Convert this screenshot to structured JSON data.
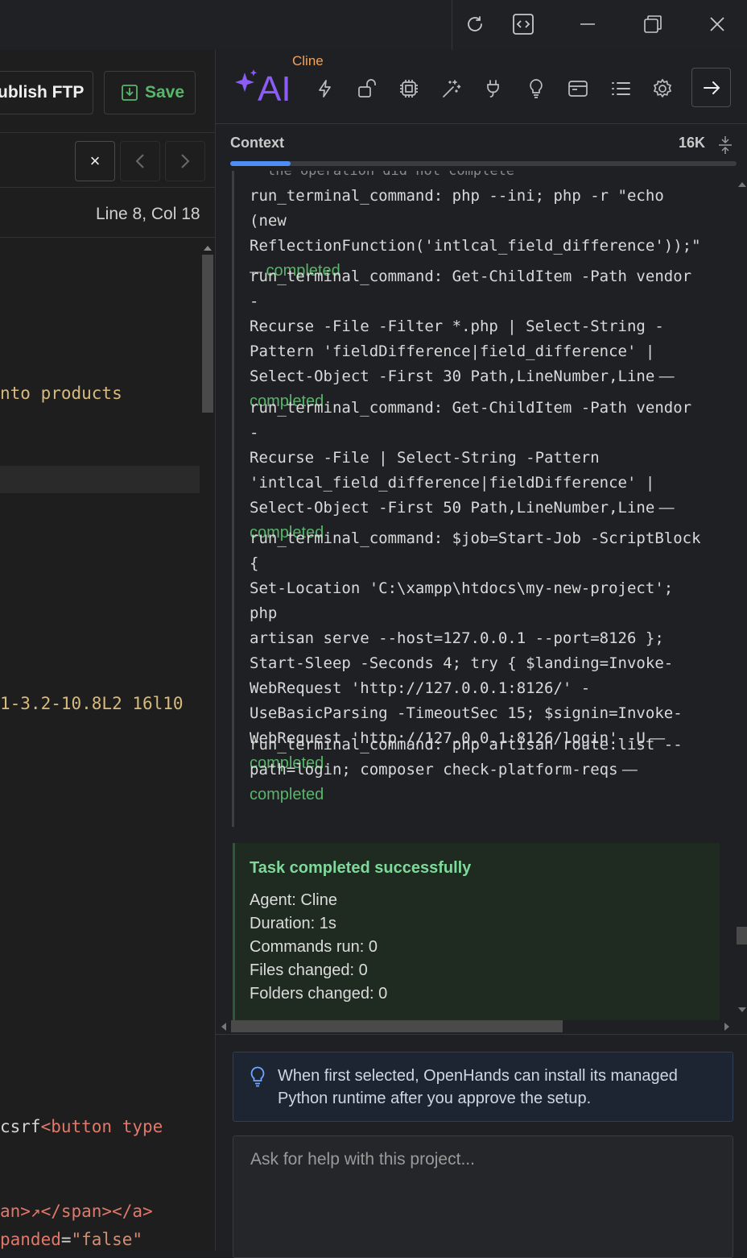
{
  "toolbar": {
    "publish_label": "ublish FTP",
    "save_label": "Save"
  },
  "editor": {
    "close_glyph": "×",
    "cursor_position": "Line 8, Col 18",
    "code_lines": {
      "l1": "nto products",
      "l2": "1-3.2-10.8L2 16l10",
      "l3_a": "csrf",
      "l3_b": "<button type",
      "l4_a": "an>↗</span></a>",
      "l5_a": "panded",
      "l5_b": "=",
      "l5_c": "\"false\""
    }
  },
  "ai_panel": {
    "agent_name": "Cline",
    "logo_text": "AI",
    "context_label": "Context",
    "context_tokens": "16K",
    "context_fill": 0.12,
    "clipped_line": "the operation did not complete",
    "entries": [
      {
        "lines": [
          "run_terminal_command: php --ini; php -r \"echo (new",
          "ReflectionFunction('intlcal_field_difference'));\""
        ],
        "suffix": "— ",
        "status": "completed",
        "status_inline": true
      },
      {
        "lines": [
          "run_terminal_command: Get-ChildItem -Path vendor -",
          "Recurse -File -Filter *.php | Select-String -",
          "Pattern 'fieldDifference|field_difference' |",
          "Select-Object -First 30 Path,LineNumber,Line"
        ],
        "suffix": " —",
        "status": "completed"
      },
      {
        "lines": [
          "run_terminal_command: Get-ChildItem -Path vendor -",
          "Recurse -File | Select-String -Pattern",
          "'intlcal_field_difference|fieldDifference' |",
          "Select-Object -First 50 Path,LineNumber,Line"
        ],
        "suffix": " —",
        "status": "completed"
      },
      {
        "lines": [
          "run_terminal_command: $job=Start-Job -ScriptBlock {",
          "Set-Location 'C:\\xampp\\htdocs\\my-new-project'; php",
          "artisan serve --host=127.0.0.1 --port=8126 };",
          "Start-Sleep -Seconds 4; try { $landing=Invoke-",
          "WebRequest 'http://127.0.0.1:8126/' -",
          "UseBasicParsing -TimeoutSec 15; $signin=Invoke-",
          "WebRequest 'http://127.0.0.1:8126/login' -U"
        ],
        "suffix": " —",
        "status": "completed"
      },
      {
        "lines": [
          "run_terminal_command: php artisan route:list --",
          "path=login; composer check-platform-reqs"
        ],
        "suffix": " —",
        "status": "completed"
      }
    ],
    "task": {
      "title": "Task completed successfully",
      "agent": "Agent: Cline",
      "duration": "Duration: 1s",
      "commands": "Commands run: 0",
      "files": "Files changed: 0",
      "folders": "Folders changed: 0"
    },
    "hint_text": "When first selected, OpenHands can install its managed Python runtime after you approve the setup.",
    "input_placeholder": "Ask for help with this project..."
  },
  "colors": {
    "accent_purple": "#8b5cf6",
    "cline_orange": "#f0a35e",
    "success_green": "#58b56a",
    "task_title_green": "#7fd99a"
  }
}
